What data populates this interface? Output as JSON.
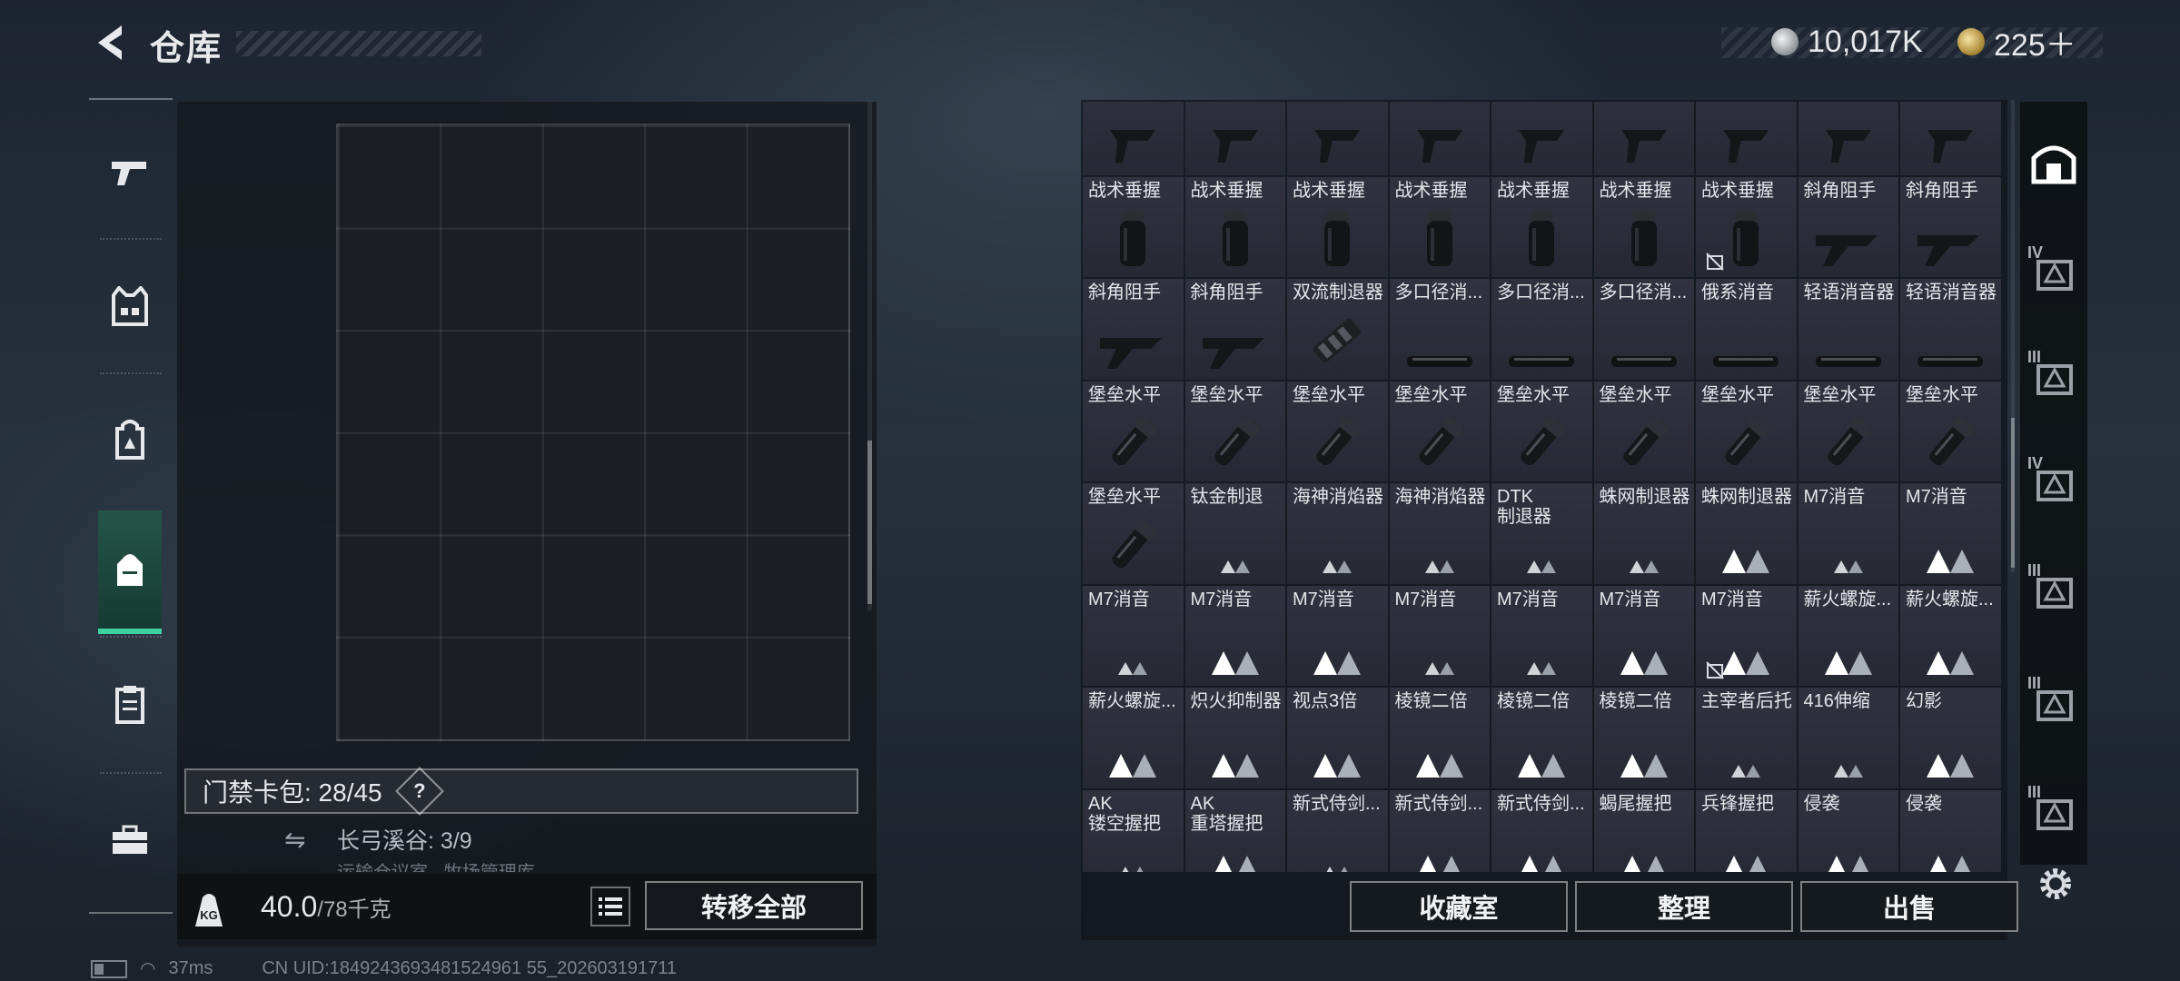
{
  "header": {
    "title": "仓库"
  },
  "currency": {
    "silver": "10,017K",
    "gold": "225＋"
  },
  "left_sidebar": {
    "items": [
      "gun-icon",
      "vest-icon",
      "backpack-icon",
      "bag-icon",
      "clipboard-icon",
      "toolbox-icon"
    ],
    "active": 3
  },
  "left_panel": {
    "card_bag_label": "门禁卡包: 28/45",
    "card_bag_help": "?",
    "map_label": "长弓溪谷: 3/9",
    "map_sub": "运输仓议室 · 牧场管理库",
    "weight_value": "40.0",
    "weight_max": "/78千克",
    "kg_label": "KG",
    "transfer_all": "转移全部"
  },
  "items": [
    {
      "label": "",
      "icon": "grip"
    },
    {
      "label": "",
      "icon": "grip"
    },
    {
      "label": "",
      "icon": "grip"
    },
    {
      "label": "",
      "icon": "grip"
    },
    {
      "label": "",
      "icon": "grip"
    },
    {
      "label": "",
      "icon": "grip"
    },
    {
      "label": "",
      "icon": "grip"
    },
    {
      "label": "",
      "icon": "grip"
    },
    {
      "label": "",
      "icon": "grip"
    },
    {
      "label": "战术垂握",
      "icon": "vgrip"
    },
    {
      "label": "战术垂握",
      "icon": "vgrip"
    },
    {
      "label": "战术垂握",
      "icon": "vgrip"
    },
    {
      "label": "战术垂握",
      "icon": "vgrip"
    },
    {
      "label": "战术垂握",
      "icon": "vgrip"
    },
    {
      "label": "战术垂握",
      "icon": "vgrip"
    },
    {
      "label": "战术垂握",
      "icon": "vgrip",
      "tag": true
    },
    {
      "label": "斜角阻手",
      "icon": "angled"
    },
    {
      "label": "斜角阻手",
      "icon": "angled"
    },
    {
      "label": "斜角阻手",
      "icon": "angled"
    },
    {
      "label": "斜角阻手",
      "icon": "angled"
    },
    {
      "label": "双流制退器",
      "icon": "brake"
    },
    {
      "label": "多口径消...",
      "icon": "supp"
    },
    {
      "label": "多口径消...",
      "icon": "supp"
    },
    {
      "label": "多口径消...",
      "icon": "supp"
    },
    {
      "label": "俄系消音",
      "icon": "supp"
    },
    {
      "label": "轻语消音器",
      "icon": "supp"
    },
    {
      "label": "轻语消音器",
      "icon": "supp"
    },
    {
      "label": "堡垒水平",
      "icon": "flash"
    },
    {
      "label": "堡垒水平",
      "icon": "flash"
    },
    {
      "label": "堡垒水平",
      "icon": "flash"
    },
    {
      "label": "堡垒水平",
      "icon": "flash"
    },
    {
      "label": "堡垒水平",
      "icon": "flash"
    },
    {
      "label": "堡垒水平",
      "icon": "flash"
    },
    {
      "label": "堡垒水平",
      "icon": "flash"
    },
    {
      "label": "堡垒水平",
      "icon": "flash"
    },
    {
      "label": "堡垒水平",
      "icon": "flash"
    },
    {
      "label": "堡垒水平",
      "icon": "flash"
    },
    {
      "label": "钛金制退",
      "icon": "tri-s"
    },
    {
      "label": "海神消焰器",
      "icon": "tri-s"
    },
    {
      "label": "海神消焰器",
      "icon": "tri-s"
    },
    {
      "label": "DTK\n制退器",
      "icon": "tri-s"
    },
    {
      "label": "蛛网制退器",
      "icon": "tri-s"
    },
    {
      "label": "蛛网制退器",
      "icon": "tri-l"
    },
    {
      "label": "M7消音",
      "icon": "tri-s"
    },
    {
      "label": "M7消音",
      "icon": "tri-l"
    },
    {
      "label": "M7消音",
      "icon": "tri-s"
    },
    {
      "label": "M7消音",
      "icon": "tri-l"
    },
    {
      "label": "M7消音",
      "icon": "tri-l"
    },
    {
      "label": "M7消音",
      "icon": "tri-s"
    },
    {
      "label": "M7消音",
      "icon": "tri-s"
    },
    {
      "label": "M7消音",
      "icon": "tri-l"
    },
    {
      "label": "M7消音",
      "icon": "tri-l",
      "tag": true
    },
    {
      "label": "薪火螺旋...",
      "icon": "tri-l"
    },
    {
      "label": "薪火螺旋...",
      "icon": "tri-l"
    },
    {
      "label": "薪火螺旋...",
      "icon": "tri-l"
    },
    {
      "label": "炽火抑制器",
      "icon": "tri-l"
    },
    {
      "label": "视点3倍",
      "icon": "tri-l"
    },
    {
      "label": "棱镜二倍",
      "icon": "tri-l"
    },
    {
      "label": "棱镜二倍",
      "icon": "tri-l"
    },
    {
      "label": "棱镜二倍",
      "icon": "tri-l"
    },
    {
      "label": "主宰者后托",
      "icon": "tri-s"
    },
    {
      "label": "416伸缩",
      "icon": "tri-s"
    },
    {
      "label": "幻影",
      "icon": "tri-l"
    },
    {
      "label": "AK\n镂空握把",
      "icon": "tri-s"
    },
    {
      "label": "AK\n重塔握把",
      "icon": "tri-l"
    },
    {
      "label": "新式侍剑...",
      "icon": "tri-s"
    },
    {
      "label": "新式侍剑...",
      "icon": "tri-l"
    },
    {
      "label": "新式侍剑...",
      "icon": "tri-l"
    },
    {
      "label": "蝎尾握把",
      "icon": "tri-l"
    },
    {
      "label": "兵锋握把",
      "icon": "tri-l"
    },
    {
      "label": "侵袭",
      "icon": "tri-l"
    },
    {
      "label": "侵袭",
      "icon": "tri-l"
    }
  ],
  "bottom_buttons": {
    "collection": "收藏室",
    "organize": "整理",
    "sell": "出售"
  },
  "right_sidebar": {
    "tiers": [
      "IV",
      "III",
      "IV",
      "III",
      "III",
      "III"
    ]
  },
  "status": {
    "ping": "37ms",
    "uid": "CN UID:1849243693481524961 55_202603191711"
  },
  "colors": {
    "accent": "#3fd1a0",
    "panel": "#30333f"
  }
}
